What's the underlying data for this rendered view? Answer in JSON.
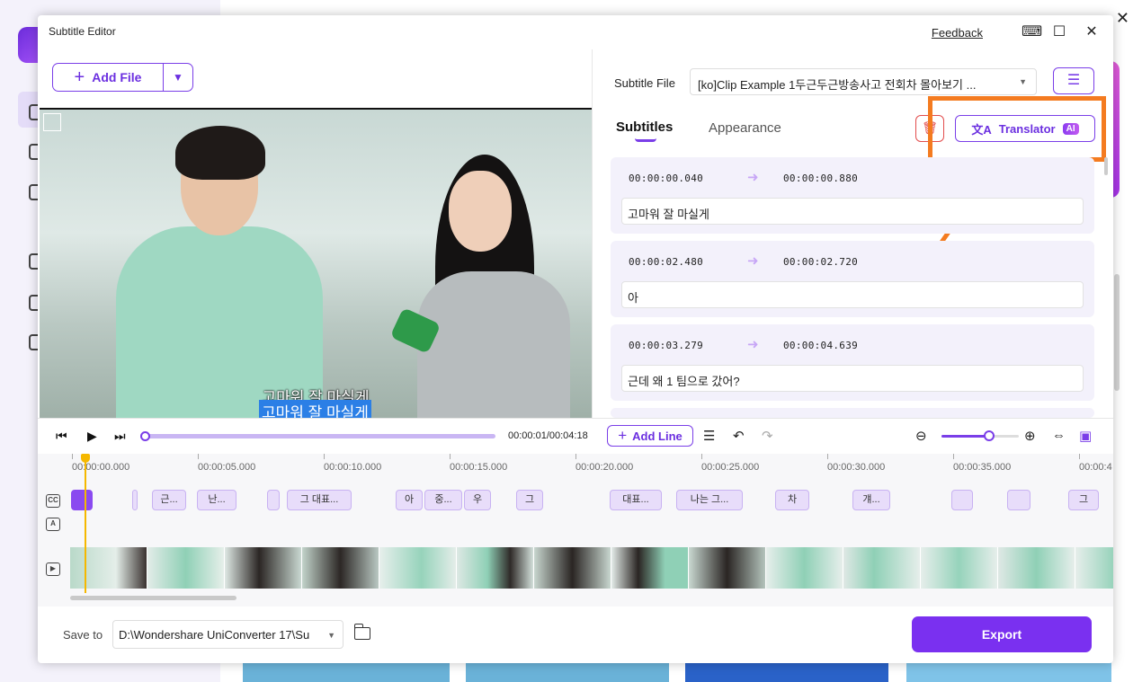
{
  "dialog": {
    "title": "Subtitle Editor",
    "feedback": "Feedback"
  },
  "left": {
    "add_file": "Add File",
    "subtitle_overlay_1": "고마워 잘 마실게",
    "subtitle_overlay_2": "고마워 잘 마실게",
    "timecode": "00:00:01/00:04:18"
  },
  "right": {
    "subtitle_file_label": "Subtitle File",
    "subtitle_file_value": "[ko]Clip Example 1두근두근방송사고 전회차 몰아보기 ...",
    "tabs": [
      "Subtitles",
      "Appearance"
    ],
    "translator": "Translator",
    "ai_badge": "AI",
    "items": [
      {
        "start": "00:00:00.040",
        "end": "00:00:00.880",
        "text": "고마워 잘 마실게"
      },
      {
        "start": "00:00:02.480",
        "end": "00:00:02.720",
        "text": "아"
      },
      {
        "start": "00:00:03.279",
        "end": "00:00:04.639",
        "text": "근데 왜 1 팀으로 갔어?"
      }
    ]
  },
  "toolbar": {
    "add_line": "Add Line"
  },
  "timeline": {
    "ticks": [
      "00:00:00.000",
      "00:00:05.000",
      "00:00:10.000",
      "00:00:15.000",
      "00:00:20.000",
      "00:00:25.000",
      "00:00:30.000",
      "00:00:35.000",
      "00:00:4"
    ],
    "clips": [
      "",
      "",
      "근...",
      "난...",
      "",
      "그 대표...",
      "아",
      "중...",
      "우",
      "그",
      "대표...",
      "나는 그...",
      "차",
      "걔...",
      "",
      "",
      "그"
    ],
    "track_icons": [
      "CC",
      "A",
      "▶"
    ]
  },
  "footer": {
    "save_label": "Save to",
    "save_path": "D:\\Wondershare UniConverter 17\\Su",
    "export": "Export"
  },
  "colors": {
    "accent": "#7a30f0",
    "highlight": "#f47b20"
  }
}
